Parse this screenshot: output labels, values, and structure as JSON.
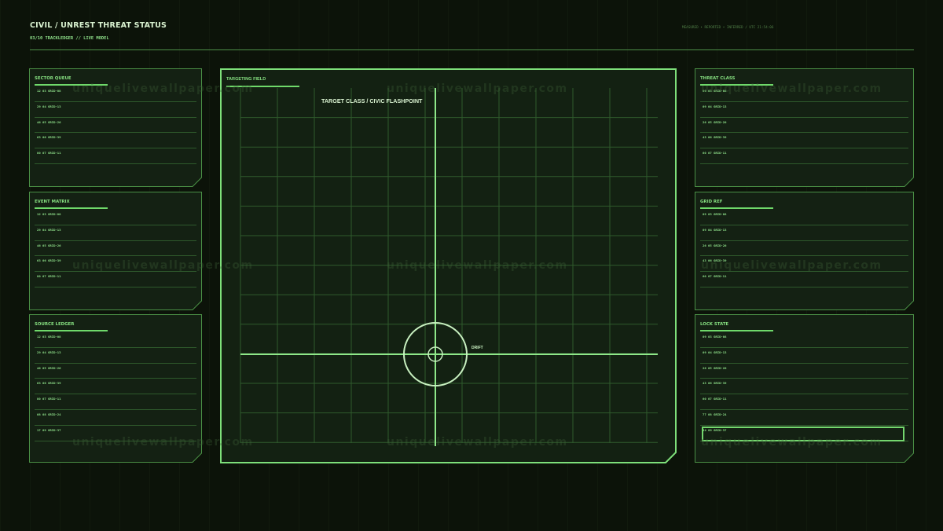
{
  "header": {
    "title": "CIVIL / UNREST THREAT STATUS",
    "subtitle": "03/10 TRACKLEDGER // LIVE MODEL",
    "right_meta": "MEASURED • REPORTED • INFERRED / UTC 21:54:06"
  },
  "left_panels": [
    {
      "title": "SECTOR QUEUE",
      "rows": [
        "12 03 GRID-08",
        "29 04 GRID-13",
        "46 05 GRID-26",
        "63 06 GRID-39",
        "80 07 GRID-11"
      ]
    },
    {
      "title": "EVENT MATRIX",
      "rows": [
        "12 03 GRID-08",
        "29 04 GRID-13",
        "46 05 GRID-26",
        "63 06 GRID-39",
        "80 07 GRID-11"
      ]
    },
    {
      "title": "SOURCE LEDGER",
      "rows": [
        "12 03 GRID-08",
        "29 04 GRID-13",
        "46 05 GRID-26",
        "63 06 GRID-39",
        "80 07 GRID-11",
        "08 08 GRID-24",
        "17 09 GRID-37"
      ]
    }
  ],
  "right_panels": [
    {
      "title": "THREAT CLASS",
      "rows": [
        "09 03 GRID-08",
        "09 04 GRID-13",
        "26 05 GRID-26",
        "43 06 GRID-39",
        "60 07 GRID-11"
      ]
    },
    {
      "title": "GRID REF",
      "rows": [
        "09 03 GRID-08",
        "09 04 GRID-13",
        "26 05 GRID-26",
        "43 06 GRID-39",
        "60 07 GRID-11"
      ]
    },
    {
      "title": "LOCK STATE",
      "rows": [
        "09 03 GRID-08",
        "09 04 GRID-13",
        "26 05 GRID-26",
        "43 06 GRID-39",
        "60 07 GRID-11",
        "77 08 GRID-24",
        "94 09 GRID-37"
      ],
      "selected_row": 6
    }
  ],
  "targeting": {
    "title": "TARGETING FIELD",
    "target_label": "TARGET CLASS / CIVIC FLASHPOINT",
    "drift_label": "DRIFT"
  },
  "watermark": "uniquelivewallpaper.com",
  "colors": {
    "accent": "#7ee07a",
    "background": "#0c1309",
    "panel_border": "#4a8f45"
  }
}
